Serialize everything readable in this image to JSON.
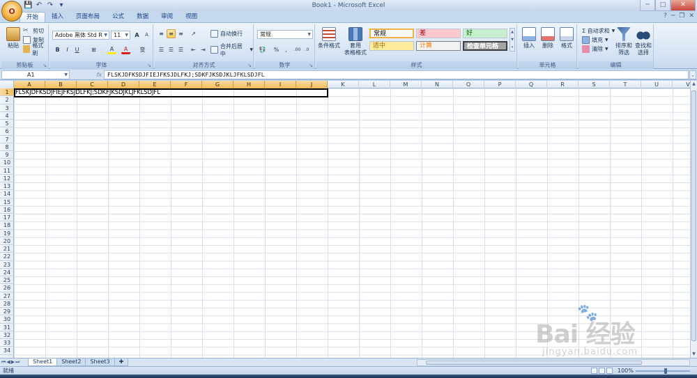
{
  "window": {
    "title": "Book1 - Microsoft Excel",
    "office_button_label": "O",
    "qat": {
      "save": "💾",
      "undo": "↶",
      "redo": "↷",
      "customize": "▾"
    },
    "controls": {
      "minimize": "─",
      "maximize": "□",
      "close": "✕"
    },
    "ribbon_controls": {
      "minimize": "─",
      "restore": "❐",
      "close": "✕",
      "help": "?"
    }
  },
  "tabs": [
    "开始",
    "插入",
    "页面布局",
    "公式",
    "数据",
    "审阅",
    "视图"
  ],
  "ribbon": {
    "clipboard": {
      "label": "剪贴板",
      "paste": "粘贴",
      "cut": "剪切",
      "copy": "复制",
      "format_painter": "格式刷"
    },
    "font": {
      "label": "字体",
      "font_name": "Adobe 黑体 Std R",
      "font_size": "11",
      "grow": "A",
      "shrink": "A",
      "bold": "B",
      "italic": "I",
      "underline": "U",
      "border": "⊞",
      "fill": "A",
      "color": "A",
      "phonetic": "变"
    },
    "alignment": {
      "label": "对齐方式",
      "wrap_text": "自动换行",
      "merge_center": "合并后居中"
    },
    "number": {
      "label": "数字",
      "format": "常规",
      "percent": "%",
      "comma": ",",
      "inc_decimal": ".00",
      "dec_decimal": ".0"
    },
    "styles": {
      "label": "样式",
      "conditional_formatting": "条件格式",
      "format_as_table_1": "套用",
      "format_as_table_2": "表格格式",
      "normal": "常规",
      "bad": "差",
      "good": "好",
      "neutral": "适中",
      "calculation": "计算",
      "check_cell": "检查单元格"
    },
    "cells": {
      "label": "单元格",
      "insert": "插入",
      "delete": "删除",
      "format": "格式"
    },
    "editing": {
      "label": "编辑",
      "autosum": "Σ 自动求和",
      "fill": "填充",
      "clear": "清除",
      "sort_filter_1": "排序和",
      "sort_filter_2": "筛选",
      "find_select_1": "查找和",
      "find_select_2": "选择"
    }
  },
  "formula_bar": {
    "name_box": "A1",
    "fx": "fx",
    "formula": "FLSKJDFKSDJFIEJFKSJDLFKJ;SDKFJKSDJKLJFKLSDJFL"
  },
  "grid": {
    "columns": [
      "A",
      "B",
      "C",
      "D",
      "E",
      "F",
      "G",
      "H",
      "I",
      "J",
      "K",
      "L",
      "M",
      "N",
      "O",
      "P",
      "Q",
      "R",
      "S",
      "T",
      "U",
      "V"
    ],
    "rows": [
      "1",
      "2",
      "3",
      "4",
      "5",
      "6",
      "7",
      "8",
      "9",
      "10",
      "11",
      "12",
      "13",
      "14",
      "15",
      "16",
      "17",
      "18",
      "19",
      "20",
      "21",
      "22",
      "23",
      "24",
      "25",
      "26",
      "27",
      "28",
      "29",
      "30",
      "31",
      "32",
      "33",
      "34"
    ],
    "selected_cell": "A1",
    "a1_value": "FLSKJDFKSDJFIEJFKSJDLFKJ;SDKFJKSDJKLJFKLSDJFL"
  },
  "sheets": [
    "Sheet1",
    "Sheet2",
    "Sheet3"
  ],
  "status": {
    "ready": "就绪",
    "zoom": "100%"
  },
  "watermark": {
    "brand": "Bai  经验",
    "url": "jingyan.baidu.com"
  }
}
